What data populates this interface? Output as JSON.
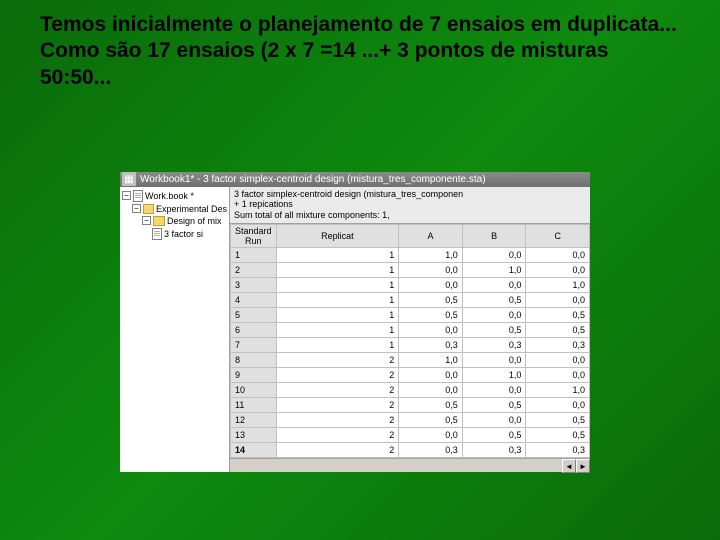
{
  "slide": {
    "text": "Temos inicialmente o planejamento de 7 ensaios em duplicata... Como são 17 ensaios  (2 x 7 =14 ...+ 3 pontos de misturas 50:50..."
  },
  "window": {
    "title": "Workbook1* - 3 factor simplex-centroid design (mistura_tres_componente.sta)"
  },
  "tree": {
    "root": "Work.book *",
    "node1": "Experimental Des",
    "node2": "Design of mix",
    "node3": "3 factor si"
  },
  "desc": {
    "line1": "3 factor simplex-centroid design (mistura_tres_componen",
    "line2": "+ 1 repications",
    "line3": "Sum total of all mixture components: 1,"
  },
  "columns": {
    "c0": "Standard Run",
    "c1": "Replicat",
    "c2": "A",
    "c3": "B",
    "c4": "C"
  },
  "rows": [
    {
      "n": "1",
      "rep": "1",
      "a": "1,0",
      "b": "0,0",
      "c": "0,0"
    },
    {
      "n": "2",
      "rep": "1",
      "a": "0,0",
      "b": "1,0",
      "c": "0,0"
    },
    {
      "n": "3",
      "rep": "1",
      "a": "0,0",
      "b": "0,0",
      "c": "1,0"
    },
    {
      "n": "4",
      "rep": "1",
      "a": "0,5",
      "b": "0,5",
      "c": "0,0"
    },
    {
      "n": "5",
      "rep": "1",
      "a": "0,5",
      "b": "0,0",
      "c": "0,5"
    },
    {
      "n": "6",
      "rep": "1",
      "a": "0,0",
      "b": "0,5",
      "c": "0,5"
    },
    {
      "n": "7",
      "rep": "1",
      "a": "0,3",
      "b": "0,3",
      "c": "0,3"
    },
    {
      "n": "8",
      "rep": "2",
      "a": "1,0",
      "b": "0,0",
      "c": "0,0"
    },
    {
      "n": "9",
      "rep": "2",
      "a": "0,0",
      "b": "1,0",
      "c": "0,0"
    },
    {
      "n": "10",
      "rep": "2",
      "a": "0,0",
      "b": "0,0",
      "c": "1,0"
    },
    {
      "n": "11",
      "rep": "2",
      "a": "0,5",
      "b": "0,5",
      "c": "0,0"
    },
    {
      "n": "12",
      "rep": "2",
      "a": "0,5",
      "b": "0,0",
      "c": "0,5"
    },
    {
      "n": "13",
      "rep": "2",
      "a": "0,0",
      "b": "0,5",
      "c": "0,5"
    },
    {
      "n": "14",
      "rep": "2",
      "a": "0,3",
      "b": "0,3",
      "c": "0,3"
    }
  ],
  "chart_data": {
    "type": "table",
    "title": "3 factor simplex-centroid design",
    "columns": [
      "Standard Run",
      "Replicate",
      "A",
      "B",
      "C"
    ],
    "data": [
      [
        1,
        1,
        1.0,
        0.0,
        0.0
      ],
      [
        2,
        1,
        0.0,
        1.0,
        0.0
      ],
      [
        3,
        1,
        0.0,
        0.0,
        1.0
      ],
      [
        4,
        1,
        0.5,
        0.5,
        0.0
      ],
      [
        5,
        1,
        0.5,
        0.0,
        0.5
      ],
      [
        6,
        1,
        0.0,
        0.5,
        0.5
      ],
      [
        7,
        1,
        0.333,
        0.333,
        0.333
      ],
      [
        8,
        2,
        1.0,
        0.0,
        0.0
      ],
      [
        9,
        2,
        0.0,
        1.0,
        0.0
      ],
      [
        10,
        2,
        0.0,
        0.0,
        1.0
      ],
      [
        11,
        2,
        0.5,
        0.5,
        0.0
      ],
      [
        12,
        2,
        0.5,
        0.0,
        0.5
      ],
      [
        13,
        2,
        0.0,
        0.5,
        0.5
      ],
      [
        14,
        2,
        0.333,
        0.333,
        0.333
      ]
    ]
  }
}
